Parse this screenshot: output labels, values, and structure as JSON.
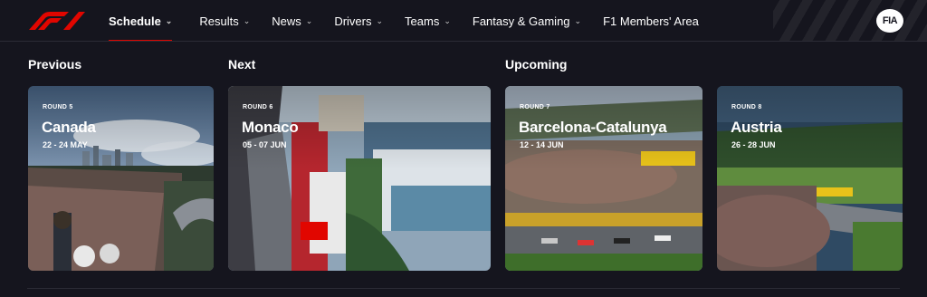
{
  "nav": {
    "items": [
      {
        "label": "Schedule",
        "dropdown": true,
        "active": true
      },
      {
        "label": "Results",
        "dropdown": true
      },
      {
        "label": "News",
        "dropdown": true
      },
      {
        "label": "Drivers",
        "dropdown": true
      },
      {
        "label": "Teams",
        "dropdown": true
      },
      {
        "label": "Fantasy & Gaming",
        "dropdown": true
      },
      {
        "label": "F1 Members' Area",
        "dropdown": false
      }
    ],
    "fia_label": "FIA"
  },
  "sections": {
    "previous": "Previous",
    "next": "Next",
    "upcoming": "Upcoming"
  },
  "cards": [
    {
      "round": "ROUND 5",
      "name": "Canada",
      "dates": "22 - 24 MAY"
    },
    {
      "round": "ROUND 6",
      "name": "Monaco",
      "dates": "05 - 07 JUN"
    },
    {
      "round": "ROUND 7",
      "name": "Barcelona-Catalunya",
      "dates": "12 - 14 JUN"
    },
    {
      "round": "ROUND 8",
      "name": "Austria",
      "dates": "26 - 28 JUN"
    }
  ],
  "colors": {
    "background": "#15151e",
    "accent": "#e10600"
  }
}
